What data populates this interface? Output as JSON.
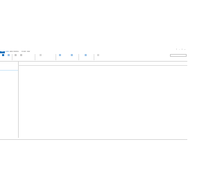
{
  "window": {
    "title": "",
    "controls": [
      "?",
      "–",
      "□",
      "×"
    ]
  },
  "tabs": [
    "FILE",
    "HOME",
    "SEND / RECEIVE",
    "FOLDER",
    "VIEW"
  ],
  "ribbon": {
    "buttons": [
      "",
      "",
      "",
      "",
      "",
      "",
      "",
      "",
      ""
    ],
    "groups": [
      "",
      "",
      "",
      ""
    ],
    "search_placeholder": ""
  },
  "nav": {
    "items": [
      "",
      "",
      "",
      "",
      "",
      "",
      "",
      "",
      "",
      ""
    ],
    "selected_index": 3
  },
  "list": {
    "filter": "",
    "columns": [
      "",
      "",
      ""
    ]
  },
  "status": {
    "items": [
      "",
      "",
      "",
      ""
    ]
  },
  "colors": {
    "accent": "#1e73be",
    "selection": "#cde6f7",
    "border": "#d6d6d6"
  },
  "icons": [
    "inbox-icon",
    "mail-icon",
    "folder-icon",
    "search-icon"
  ]
}
